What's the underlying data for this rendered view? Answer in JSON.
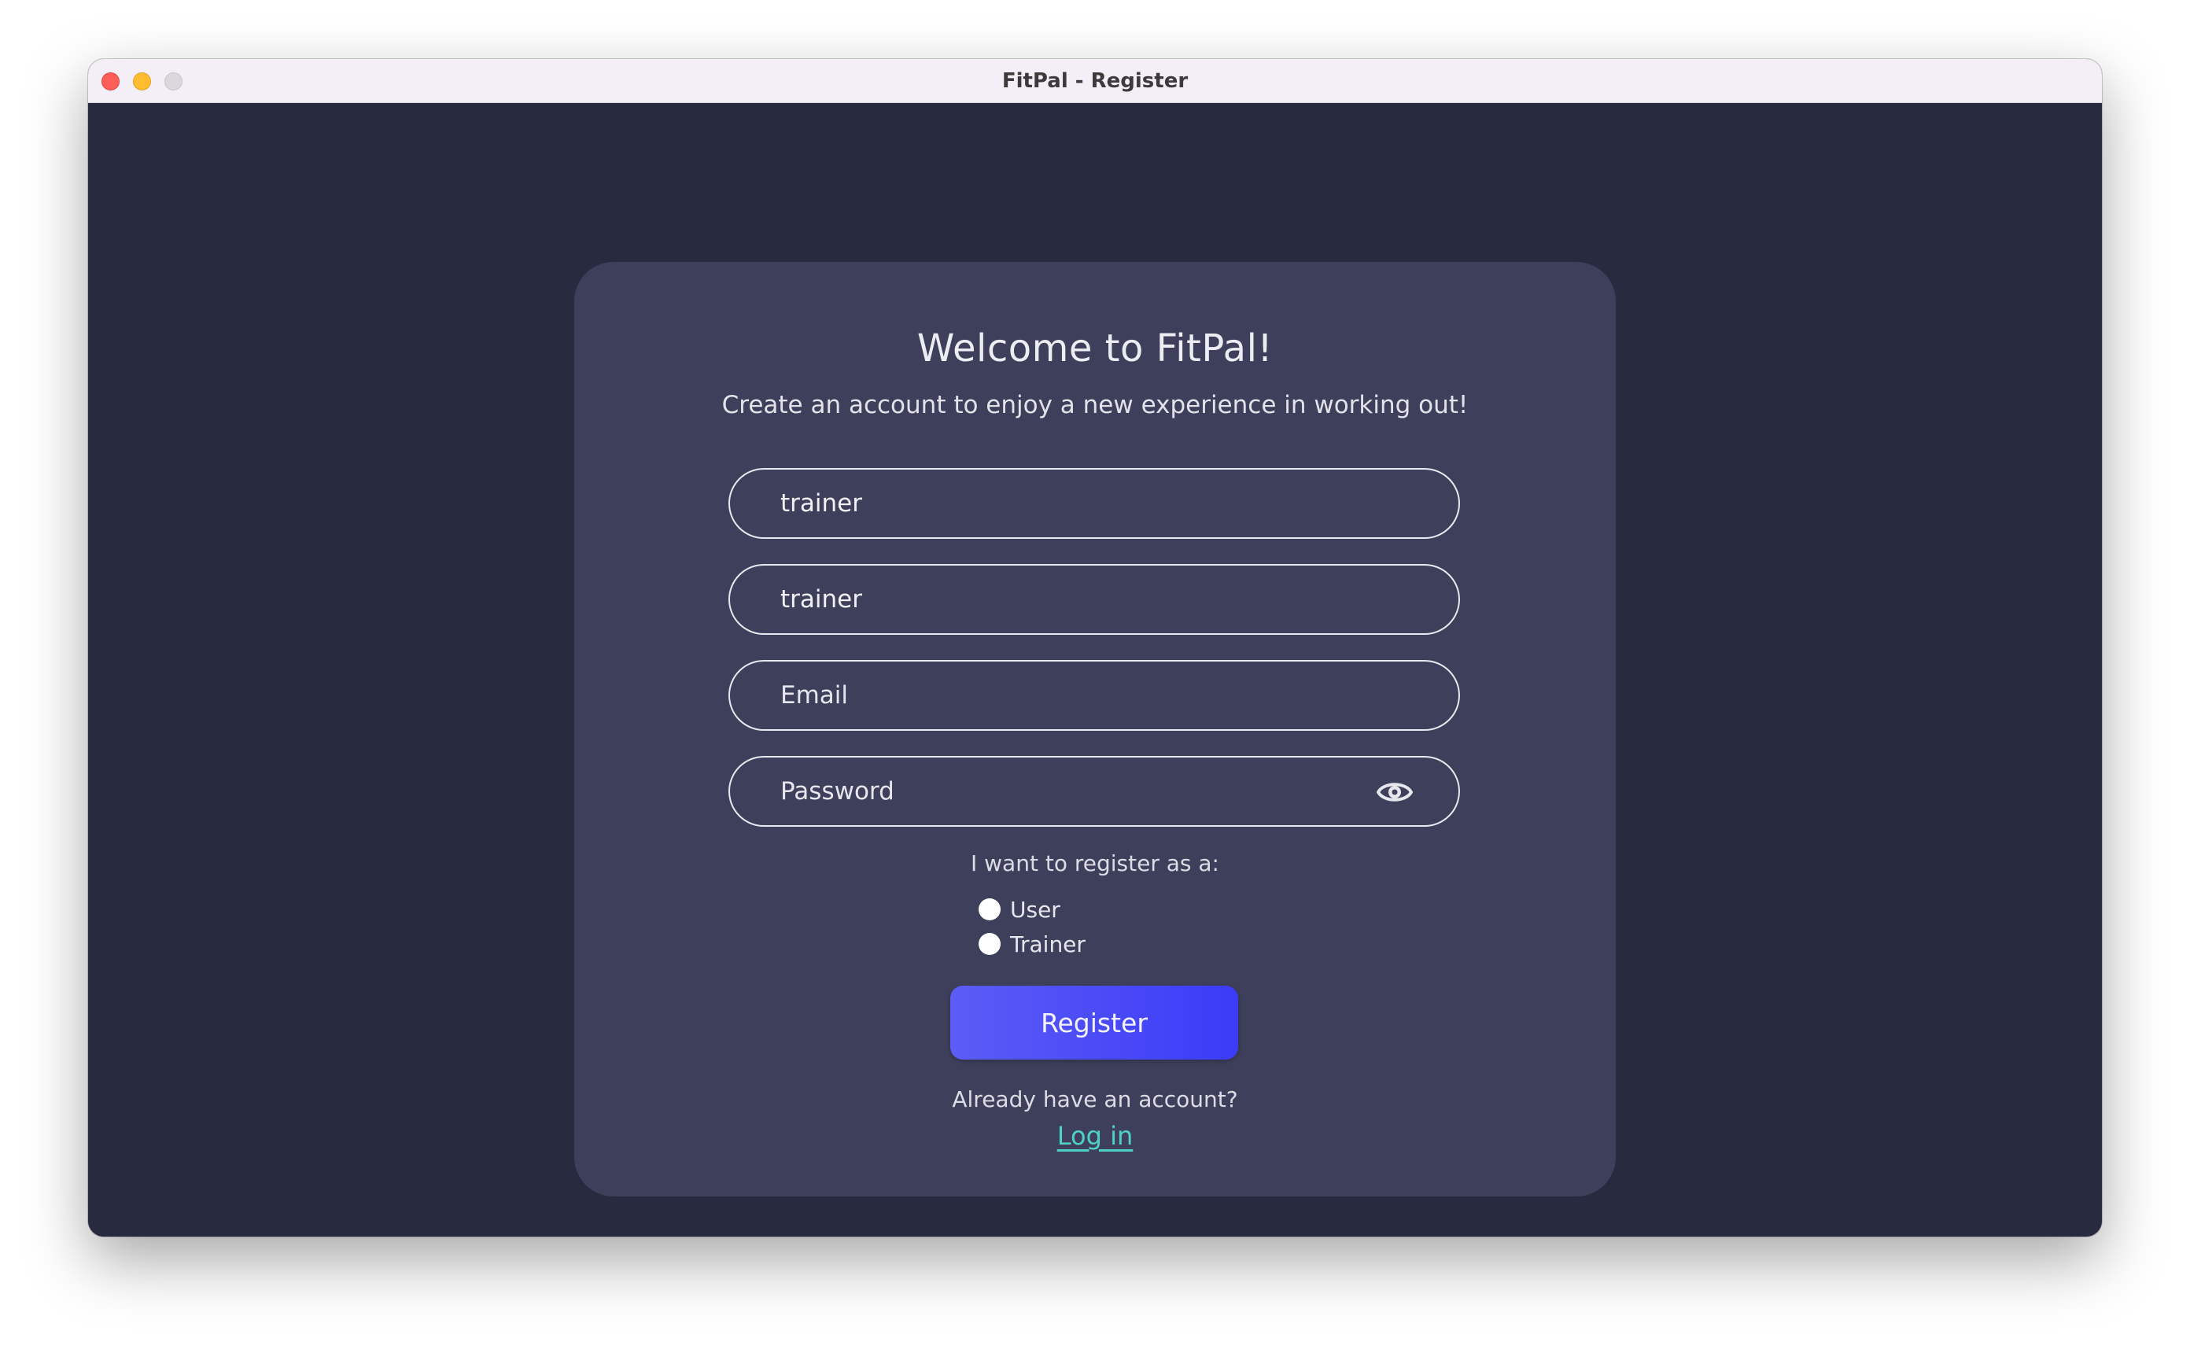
{
  "window": {
    "title": "FitPal - Register"
  },
  "card": {
    "heading": "Welcome to FitPal!",
    "subheading": "Create an account to enjoy a new experience in working out!"
  },
  "fields": {
    "first": {
      "value": "trainer",
      "placeholder": ""
    },
    "second": {
      "value": "trainer",
      "placeholder": ""
    },
    "email": {
      "value": "",
      "placeholder": "Email"
    },
    "password": {
      "value": "",
      "placeholder": "Password"
    }
  },
  "role": {
    "prompt": "I want to register as a:",
    "options": [
      "User",
      "Trainer"
    ]
  },
  "actions": {
    "register_label": "Register",
    "already_text": "Already have an account?",
    "login_label": "Log in"
  },
  "icons": {
    "password_toggle": "eye-icon"
  },
  "colors": {
    "background": "#282a3f",
    "card": "#3e3f5b",
    "accent": "#4a4af7",
    "link": "#4fd1c5"
  }
}
